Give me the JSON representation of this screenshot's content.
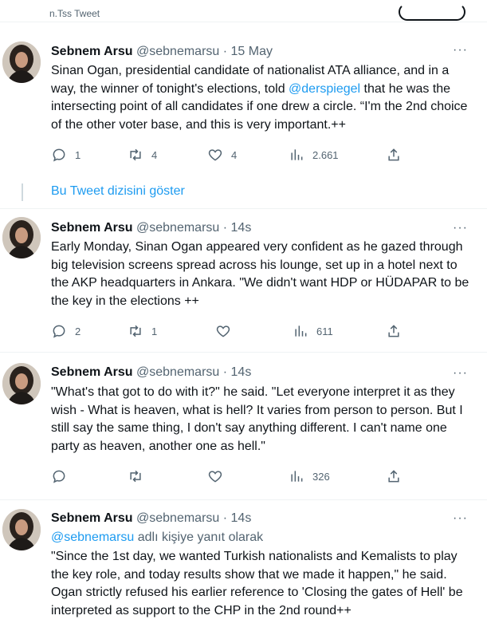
{
  "top": {
    "cut_label": "n.Tss Tweet"
  },
  "show_thread": "Bu Tweet dizisini göster",
  "tweets": [
    {
      "name": "Sebnem Arsu",
      "handle": "@sebnemarsu",
      "sep": "·",
      "date": "15 May",
      "more": "···",
      "text_before": "Sinan Ogan, presidential candidate of nationalist ATA alliance, and in a way, the winner of tonight's elections, told ",
      "mention": "@derspiegel",
      "text_after": " that he was the intersecting point of all candidates if one drew a circle. “I'm the 2nd choice of the other voter base, and this is very important.++",
      "replies": "1",
      "retweets": "4",
      "likes": "4",
      "views": "2.661"
    },
    {
      "name": "Sebnem Arsu",
      "handle": "@sebnemarsu",
      "sep": "·",
      "date": "14s",
      "more": "···",
      "text": "Early Monday, Sinan Ogan appeared very confident as he gazed through big television screens spread across his lounge, set up in a hotel next to the AKP headquarters in Ankara. \"We didn't want HDP or HÜDAPAR to be the key in the elections ++",
      "replies": "2",
      "retweets": "1",
      "likes": "",
      "views": "611"
    },
    {
      "name": "Sebnem Arsu",
      "handle": "@sebnemarsu",
      "sep": "·",
      "date": "14s",
      "more": "···",
      "text": "\"What's that got to do with it?\" he said. \"Let everyone interpret it as they wish - What is heaven, what is hell? It varies from person to person. But I still say the same thing, I don't say anything different. I can't name one party as heaven, another one as hell.\"",
      "replies": "",
      "retweets": "",
      "likes": "",
      "views": "326"
    },
    {
      "name": "Sebnem Arsu",
      "handle": "@sebnemarsu",
      "sep": "·",
      "date": "14s",
      "more": "···",
      "reply_mention": "@sebnemarsu",
      "reply_suffix": " adlı kişiye yanıt olarak",
      "text": "\"Since the 1st day, we wanted Turkish nationalists and Kemalists to play the key role, and today results show that we made it happen,\" he said. Ogan strictly refused his earlier reference to 'Closing the gates of Hell' be interpreted as support to the CHP in the 2nd round++"
    }
  ],
  "icons": {
    "reply": "reply-icon",
    "retweet": "retweet-icon",
    "like": "heart-icon",
    "views": "views-icon",
    "share": "share-icon",
    "more": "more-icon"
  }
}
